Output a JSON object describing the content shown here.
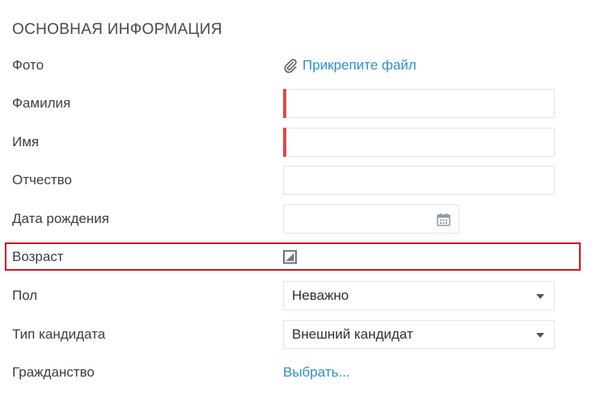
{
  "section": {
    "title": "ОСНОВНАЯ ИНФОРМАЦИЯ"
  },
  "fields": {
    "photo": {
      "label": "Фото",
      "attach_label": "Прикрепите файл",
      "icon": "paperclip-icon"
    },
    "last_name": {
      "label": "Фамилия",
      "value": "",
      "required": true
    },
    "first_name": {
      "label": "Имя",
      "value": "",
      "required": true
    },
    "middle_name": {
      "label": "Отчество",
      "value": ""
    },
    "birth_date": {
      "label": "Дата рождения",
      "value": "",
      "icon": "calendar-icon"
    },
    "age": {
      "label": "Возраст",
      "state": "indeterminate"
    },
    "gender": {
      "label": "Пол",
      "selected": "Неважно"
    },
    "candidate_type": {
      "label": "Тип кандидата",
      "selected": "Внешний кандидат"
    },
    "citizenship": {
      "label": "Гражданство",
      "link_label": "Выбрать..."
    }
  },
  "colors": {
    "link": "#2f8fc5",
    "required_marker": "#e0484d",
    "highlight_border": "#d0141e",
    "input_border": "#e4e4e4"
  }
}
